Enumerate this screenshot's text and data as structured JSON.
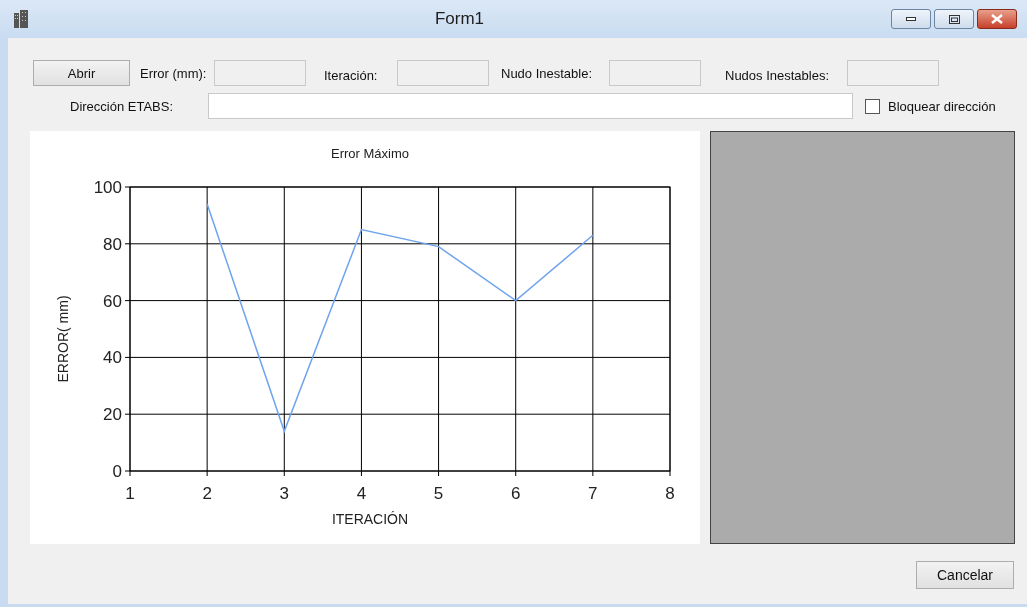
{
  "window": {
    "title": "Form1"
  },
  "toolbar": {
    "open_button": "Abrir",
    "fields": [
      {
        "label": "Error (mm):"
      },
      {
        "label": "Iteración:"
      },
      {
        "label": "Nudo Inestable:"
      },
      {
        "label": "Nudos Inestables:"
      }
    ]
  },
  "path": {
    "label": "Dirección ETABS:",
    "lock_checkbox": {
      "label": "Bloquear dirección",
      "checked": false
    }
  },
  "chart": {
    "chart_data": {
      "type": "line",
      "title": "Error Máximo",
      "xlabel": "ITERACIÓN",
      "ylabel": "ERROR( mm)",
      "x": [
        2,
        3,
        4,
        5,
        6,
        7
      ],
      "series": [
        {
          "color": "#6fa3ef",
          "values": [
            94,
            14,
            85,
            79,
            60,
            83
          ]
        }
      ],
      "grid": true,
      "xlim": [
        1,
        8
      ],
      "ylim": [
        0,
        100
      ],
      "xticks": [
        1,
        2,
        3,
        4,
        5,
        6,
        7,
        8
      ],
      "yticks": [
        0,
        20,
        40,
        60,
        80,
        100
      ]
    }
  },
  "cancel_button": "Cancelar"
}
